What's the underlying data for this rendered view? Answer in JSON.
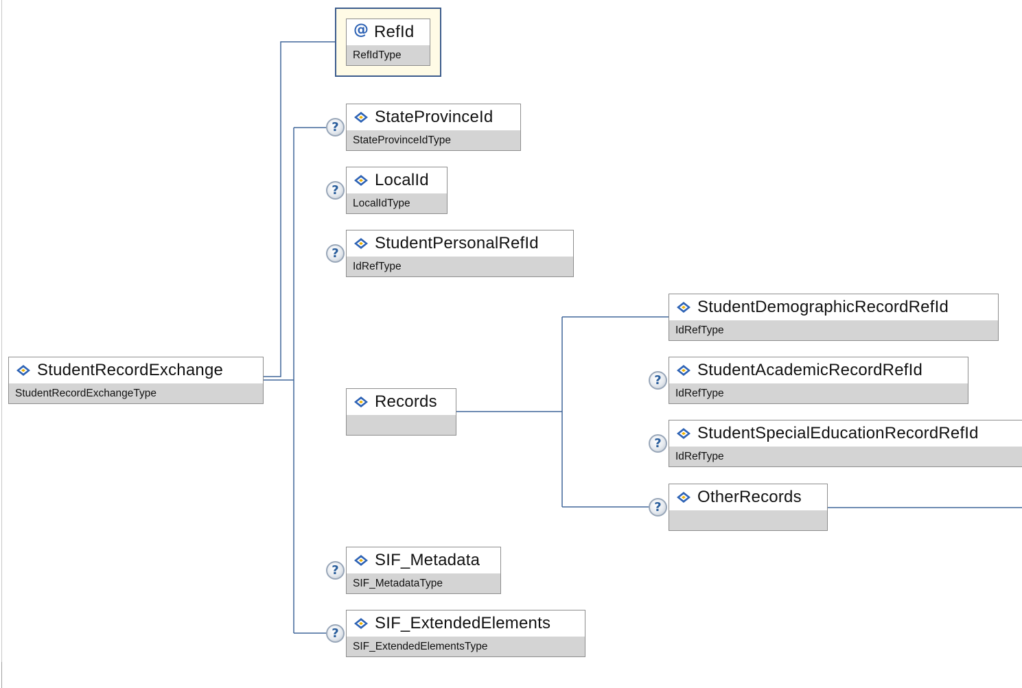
{
  "diagram": {
    "root": {
      "name": "StudentRecordExchange",
      "type": "StudentRecordExchangeType"
    },
    "attribute": {
      "name": "RefId",
      "type": "RefIdType"
    },
    "elements": [
      {
        "name": "StateProvinceId",
        "type": "StateProvinceIdType",
        "optional": true
      },
      {
        "name": "LocalId",
        "type": "LocalIdType",
        "optional": true
      },
      {
        "name": "StudentPersonalRefId",
        "type": "IdRefType",
        "optional": true
      },
      {
        "name": "Records",
        "type": "",
        "optional": false
      },
      {
        "name": "SIF_Metadata",
        "type": "SIF_MetadataType",
        "optional": true
      },
      {
        "name": "SIF_ExtendedElements",
        "type": "SIF_ExtendedElementsType",
        "optional": true
      }
    ],
    "records_children": [
      {
        "name": "StudentDemographicRecordRefId",
        "type": "IdRefType",
        "optional": false
      },
      {
        "name": "StudentAcademicRecordRefId",
        "type": "IdRefType",
        "optional": true
      },
      {
        "name": "StudentSpecialEducationRecordRefId",
        "type": "IdRefType",
        "optional": true
      },
      {
        "name": "OtherRecords",
        "type": "",
        "optional": true
      }
    ],
    "optional_marker": "?",
    "attribute_marker": "@",
    "colors": {
      "connector": "#3f6599",
      "attribute_border": "#3b5b8c",
      "attribute_fill": "#fffbe6",
      "node_border": "#8c8c8c",
      "node_type_band": "#d4d4d4",
      "icon_blue": "#2d62b4",
      "icon_gold": "#f0b400"
    }
  }
}
